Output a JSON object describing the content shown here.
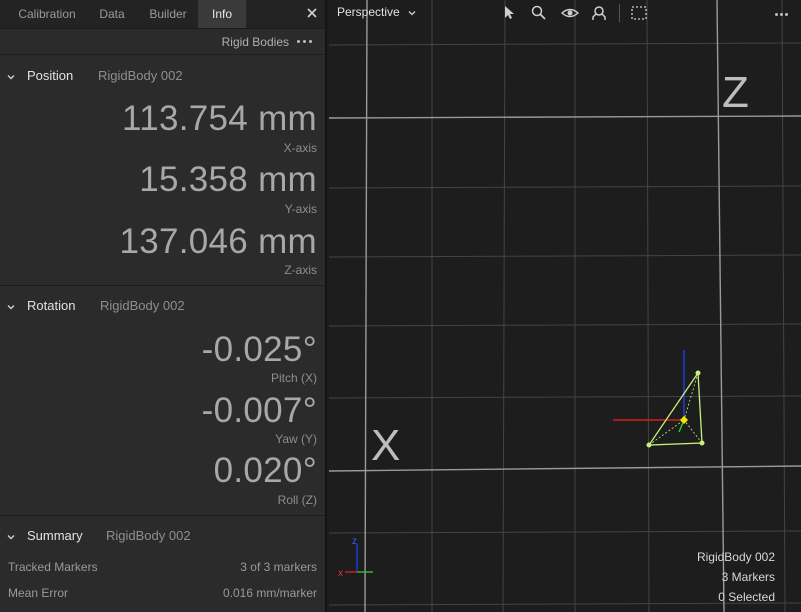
{
  "tabs": [
    "Calibration",
    "Data",
    "Builder",
    "Info"
  ],
  "subheader": {
    "label": "Rigid Bodies"
  },
  "position": {
    "title": "Position",
    "body": "RigidBody 002",
    "x": {
      "value": "113.754 mm",
      "label": "X-axis"
    },
    "y": {
      "value": "15.358 mm",
      "label": "Y-axis"
    },
    "z": {
      "value": "137.046 mm",
      "label": "Z-axis"
    }
  },
  "rotation": {
    "title": "Rotation",
    "body": "RigidBody 002",
    "pitch": {
      "value": "-0.025°",
      "label": "Pitch (X)"
    },
    "yaw": {
      "value": "-0.007°",
      "label": "Yaw (Y)"
    },
    "roll": {
      "value": "0.020°",
      "label": "Roll (Z)"
    }
  },
  "summary": {
    "title": "Summary",
    "body": "RigidBody 002",
    "tracked_label": "Tracked Markers",
    "tracked_value": "3 of 3 markers",
    "error_label": "Mean Error",
    "error_value": "0.016 mm/marker"
  },
  "viewport": {
    "mode": "Perspective",
    "axis_z": "Z",
    "axis_x": "X",
    "gizmo_z": "z",
    "gizmo_x": "x",
    "info_name": "RigidBody 002",
    "info_markers": "3 Markers",
    "info_selected": "0 Selected"
  },
  "colors": {
    "accent_yellow": "#f5e600",
    "marker_green": "#c8f07a",
    "axis_red": "#d21e1e",
    "axis_blue": "#1e3cdc",
    "axis_green": "#2ec22e"
  },
  "icons": [
    "close-icon",
    "more-icon",
    "chevron-down-icon",
    "cursor-icon",
    "zoom-icon",
    "eye-icon",
    "person-search-icon",
    "marquee-select-icon"
  ]
}
